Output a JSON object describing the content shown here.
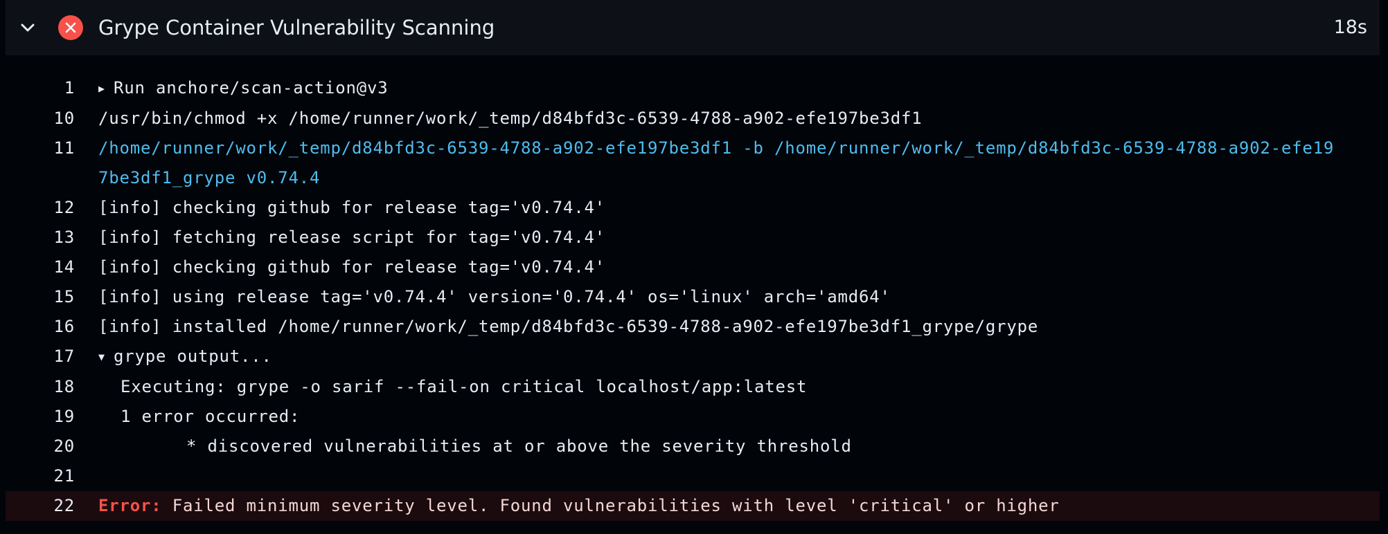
{
  "step": {
    "title": "Grype Container Vulnerability Scanning",
    "duration": "18s",
    "status": "failed",
    "status_color": "#f85149",
    "chevron_icon": "chevron-down-icon",
    "status_icon": "x-circle-icon"
  },
  "log": {
    "lines": [
      {
        "num": "1",
        "text": "Run anchore/scan-action@v3",
        "group": "collapsed"
      },
      {
        "num": "10",
        "text": "/usr/bin/chmod +x /home/runner/work/_temp/d84bfd3c-6539-4788-a902-efe197be3df1"
      },
      {
        "num": "11",
        "text": "/home/runner/work/_temp/d84bfd3c-6539-4788-a902-efe197be3df1 -b /home/runner/work/_temp/d84bfd3c-6539-4788-a902-efe197be3df1_grype v0.74.4",
        "style": "command"
      },
      {
        "num": "12",
        "text": "[info] checking github for release tag='v0.74.4'"
      },
      {
        "num": "13",
        "text": "[info] fetching release script for tag='v0.74.4'"
      },
      {
        "num": "14",
        "text": "[info] checking github for release tag='v0.74.4'"
      },
      {
        "num": "15",
        "text": "[info] using release tag='v0.74.4' version='0.74.4' os='linux' arch='amd64'"
      },
      {
        "num": "16",
        "text": "[info] installed /home/runner/work/_temp/d84bfd3c-6539-4788-a902-efe197be3df1_grype/grype"
      },
      {
        "num": "17",
        "text": "grype output...",
        "group": "expanded"
      },
      {
        "num": "18",
        "text": "Executing: grype -o sarif --fail-on critical localhost/app:latest"
      },
      {
        "num": "19",
        "text": "1 error occurred:"
      },
      {
        "num": "20",
        "text": "* discovered vulnerabilities at or above the severity threshold"
      },
      {
        "num": "21",
        "text": ""
      },
      {
        "num": "22",
        "label": "Error:",
        "text": "Failed minimum severity level. Found vulnerabilities with level 'critical' or higher",
        "style": "error"
      }
    ]
  },
  "colors": {
    "background": "#010409",
    "header_background": "#0d1117",
    "command_text": "#4fbcee",
    "error_label": "#f85149",
    "error_row_background": "#1b0b0e"
  }
}
